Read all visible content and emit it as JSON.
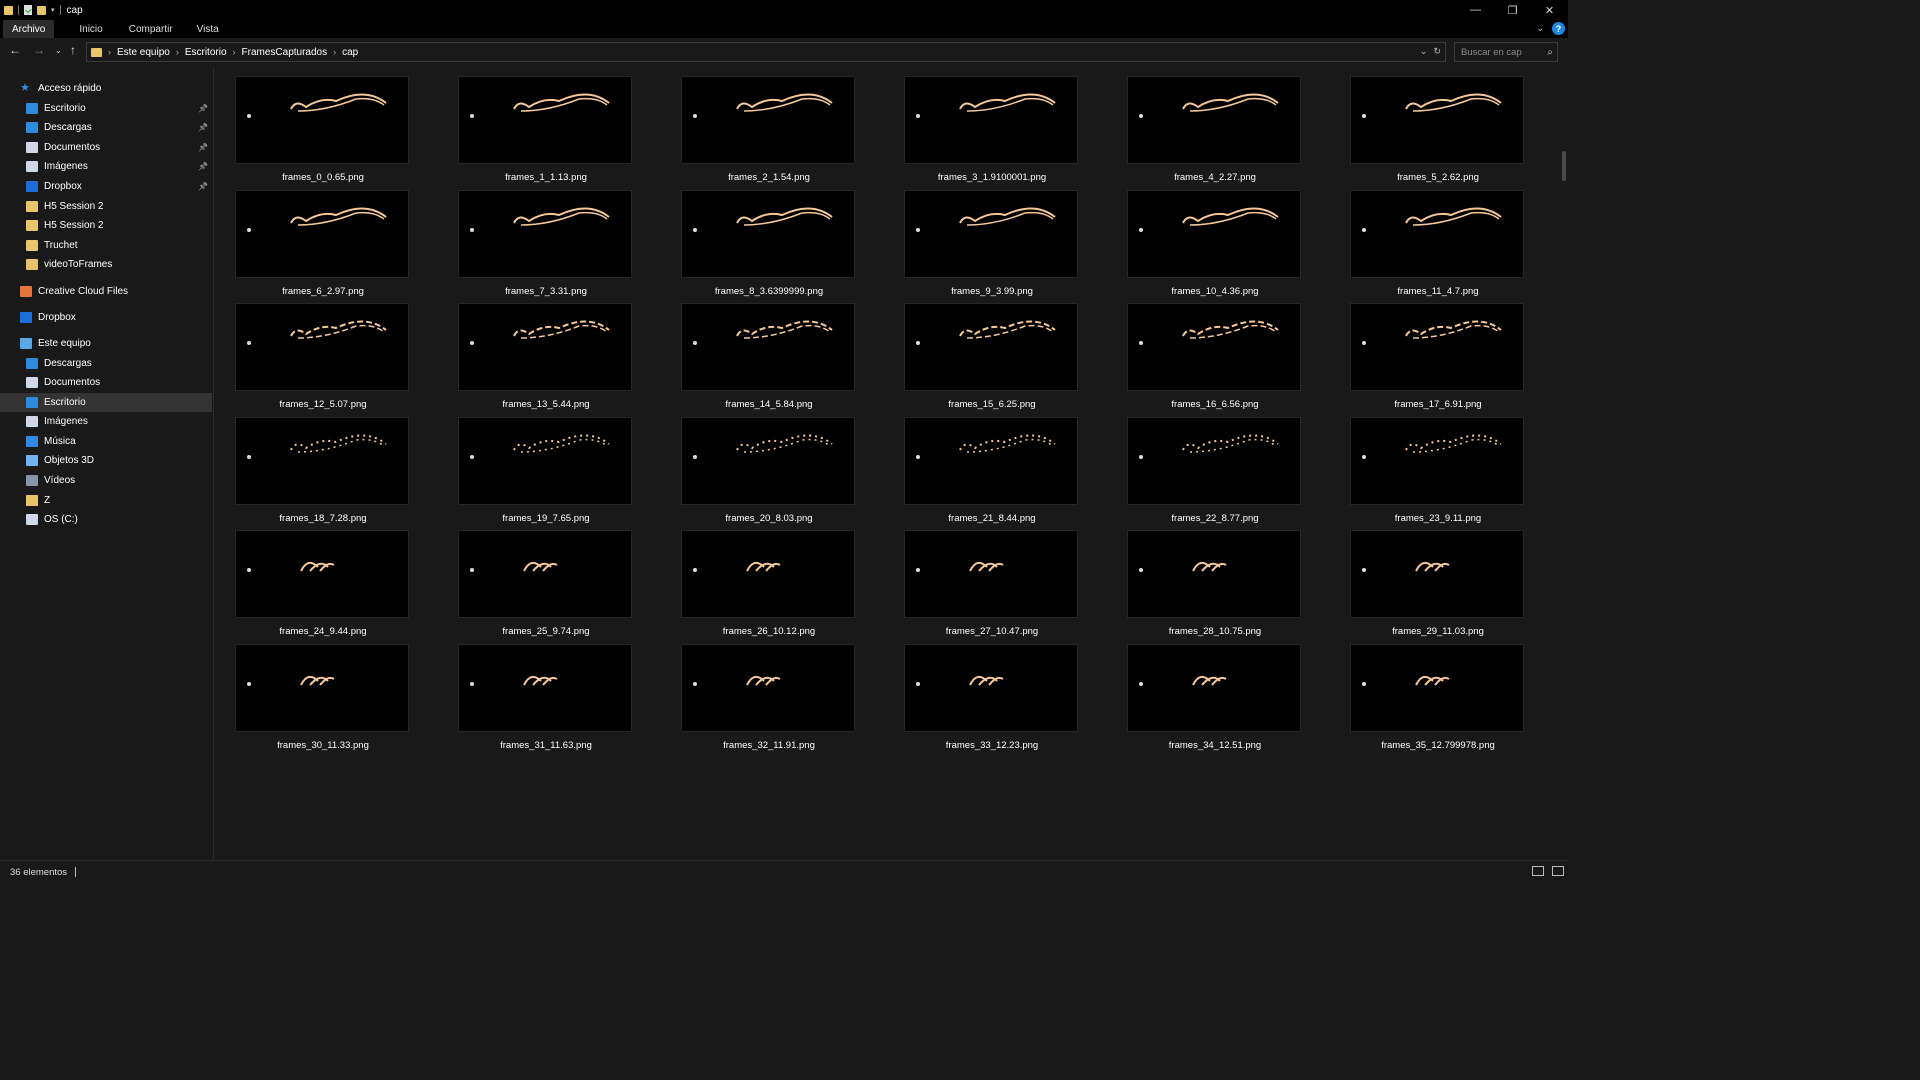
{
  "window": {
    "title": "cap",
    "controls": [
      "—",
      "❐",
      "✕"
    ]
  },
  "ribbon": {
    "tabs": [
      "Archivo",
      "Inicio",
      "Compartir",
      "Vista"
    ]
  },
  "address": {
    "crumbs": [
      "Este equipo",
      "Escritorio",
      "FramesCapturados",
      "cap"
    ]
  },
  "search": {
    "placeholder": "Buscar en cap"
  },
  "sidebar": {
    "items": [
      {
        "label": "Acceso rápido",
        "level": 0,
        "icon": "star-icon",
        "pinned": false,
        "selected": false
      },
      {
        "label": "Escritorio",
        "level": 1,
        "icon": "desktop-icon",
        "pinned": true,
        "selected": false
      },
      {
        "label": "Descargas",
        "level": 1,
        "icon": "download-icon",
        "pinned": true,
        "selected": false
      },
      {
        "label": "Documentos",
        "level": 1,
        "icon": "document-icon",
        "pinned": true,
        "selected": false
      },
      {
        "label": "Imágenes",
        "level": 1,
        "icon": "image-icon",
        "pinned": true,
        "selected": false
      },
      {
        "label": "Dropbox",
        "level": 1,
        "icon": "dropbox-icon",
        "pinned": true,
        "selected": false
      },
      {
        "label": "H5 Session 2",
        "level": 1,
        "icon": "folder-icon",
        "pinned": false,
        "selected": false
      },
      {
        "label": "H5 Session 2",
        "level": 1,
        "icon": "folder-icon",
        "pinned": false,
        "selected": false
      },
      {
        "label": "Truchet",
        "level": 1,
        "icon": "folder-icon",
        "pinned": false,
        "selected": false
      },
      {
        "label": "videoToFrames",
        "level": 1,
        "icon": "folder-icon",
        "pinned": false,
        "selected": false
      },
      {
        "label": "Creative Cloud Files",
        "level": 0,
        "icon": "creative-cloud-icon",
        "pinned": false,
        "selected": false
      },
      {
        "label": "Dropbox",
        "level": 0,
        "icon": "dropbox-icon",
        "pinned": false,
        "selected": false
      },
      {
        "label": "Este equipo",
        "level": 0,
        "icon": "computer-icon",
        "pinned": false,
        "selected": false
      },
      {
        "label": "Descargas",
        "level": 1,
        "icon": "download-icon",
        "pinned": false,
        "selected": false
      },
      {
        "label": "Documentos",
        "level": 1,
        "icon": "document-icon",
        "pinned": false,
        "selected": false
      },
      {
        "label": "Escritorio",
        "level": 1,
        "icon": "desktop-icon",
        "pinned": false,
        "selected": true
      },
      {
        "label": "Imágenes",
        "level": 1,
        "icon": "image-icon",
        "pinned": false,
        "selected": false
      },
      {
        "label": "Música",
        "level": 1,
        "icon": "music-icon",
        "pinned": false,
        "selected": false
      },
      {
        "label": "Objetos 3D",
        "level": 1,
        "icon": "cube-icon",
        "pinned": false,
        "selected": false
      },
      {
        "label": "Vídeos",
        "level": 1,
        "icon": "video-icon",
        "pinned": false,
        "selected": false
      },
      {
        "label": "Z",
        "level": 1,
        "icon": "folder-icon",
        "pinned": false,
        "selected": false
      },
      {
        "label": "OS (C:)",
        "level": 1,
        "icon": "drive-icon",
        "pinned": false,
        "selected": false
      }
    ]
  },
  "files": [
    "frames_0_0.65.png",
    "frames_1_1.13.png",
    "frames_2_1.54.png",
    "frames_3_1.9100001.png",
    "frames_4_2.27.png",
    "frames_5_2.62.png",
    "frames_6_2.97.png",
    "frames_7_3.31.png",
    "frames_8_3.6399999.png",
    "frames_9_3.99.png",
    "frames_10_4.36.png",
    "frames_11_4.7.png",
    "frames_12_5.07.png",
    "frames_13_5.44.png",
    "frames_14_5.84.png",
    "frames_15_6.25.png",
    "frames_16_6.56.png",
    "frames_17_6.91.png",
    "frames_18_7.28.png",
    "frames_19_7.65.png",
    "frames_20_8.03.png",
    "frames_21_8.44.png",
    "frames_22_8.77.png",
    "frames_23_9.11.png",
    "frames_24_9.44.png",
    "frames_25_9.74.png",
    "frames_26_10.12.png",
    "frames_27_10.47.png",
    "frames_28_10.75.png",
    "frames_29_11.03.png",
    "frames_30_11.33.png",
    "frames_31_11.63.png",
    "frames_32_11.91.png",
    "frames_33_12.23.png",
    "frames_34_12.51.png",
    "frames_35_12.799978.png"
  ],
  "status": {
    "count": "36 elementos"
  },
  "colors": {
    "folder": "#e9c46a",
    "accent": "#1e88e5",
    "stroke": "#f4c89a"
  }
}
